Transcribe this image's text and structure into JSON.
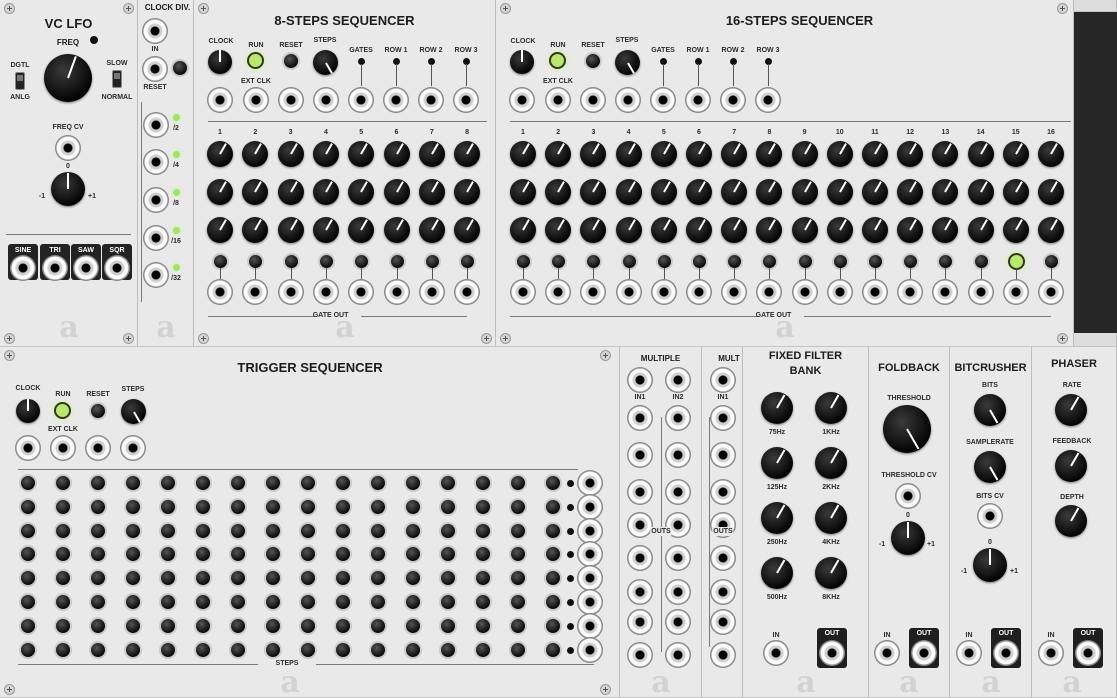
{
  "modules": {
    "vclfo": {
      "title": "VC LFO",
      "freq": "FREQ",
      "dgtl": "DGTL",
      "anlg": "ANLG",
      "slow": "SLOW",
      "normal": "NORMAL",
      "freq_cv": "FREQ CV",
      "zero": "0",
      "minus": "-1",
      "plus": "+1",
      "waves": [
        "SINE",
        "TRI",
        "SAW",
        "SQR"
      ]
    },
    "clockdiv": {
      "title": "CLOCK DIV.",
      "in": "IN",
      "reset": "RESET",
      "divisions": [
        "/2",
        "/4",
        "/8",
        "/16",
        "/32"
      ]
    },
    "seq8": {
      "title": "8-STEPS SEQUENCER",
      "clock": "CLOCK",
      "run": "RUN",
      "ext_clk": "EXT CLK",
      "reset": "RESET",
      "steps": "STEPS",
      "gates": "GATES",
      "rows": [
        "ROW 1",
        "ROW 2",
        "ROW 3"
      ],
      "step_numbers": [
        "1",
        "2",
        "3",
        "4",
        "5",
        "6",
        "7",
        "8"
      ],
      "gate_out": "GATE OUT"
    },
    "seq16": {
      "title": "16-STEPS SEQUENCER",
      "clock": "CLOCK",
      "run": "RUN",
      "ext_clk": "EXT CLK",
      "reset": "RESET",
      "steps": "STEPS",
      "gates": "GATES",
      "rows": [
        "ROW 1",
        "ROW 2",
        "ROW 3"
      ],
      "step_numbers": [
        "1",
        "2",
        "3",
        "4",
        "5",
        "6",
        "7",
        "8",
        "9",
        "10",
        "11",
        "12",
        "13",
        "14",
        "15",
        "16"
      ],
      "gate_out": "GATE OUT"
    },
    "trigseq": {
      "title": "TRIGGER SEQUENCER",
      "clock": "CLOCK",
      "run": "RUN",
      "ext_clk": "EXT CLK",
      "reset": "RESET",
      "steps": "STEPS",
      "steps_footer": "STEPS"
    },
    "multiple": {
      "title": "MULTIPLE",
      "in1": "IN1",
      "in2": "IN2",
      "outs": "OUTS"
    },
    "mult": {
      "title": "MULT",
      "in1": "IN1",
      "outs": "OUTS"
    },
    "filterbank": {
      "title_line1": "FIXED FILTER",
      "title_line2": "BANK",
      "bands": [
        "75Hz",
        "1KHz",
        "125Hz",
        "2KHz",
        "250Hz",
        "4KHz",
        "500Hz",
        "8KHz"
      ],
      "in": "IN",
      "out": "OUT"
    },
    "foldback": {
      "title": "FOLDBACK",
      "threshold": "THRESHOLD",
      "threshold_cv": "THRESHOLD CV",
      "zero": "0",
      "minus": "-1",
      "plus": "+1",
      "in": "IN",
      "out": "OUT"
    },
    "bitcrusher": {
      "title": "BITCRUSHER",
      "bits": "BITS",
      "samplerate": "SAMPLERATE",
      "bits_cv": "BITS CV",
      "zero": "0",
      "minus": "-1",
      "plus": "+1",
      "in": "IN",
      "out": "OUT"
    },
    "phaser": {
      "title": "PHASER",
      "rate": "RATE",
      "feedback": "FEEDBACK",
      "depth": "DEPTH",
      "in": "IN",
      "out": "OUT"
    }
  },
  "seq16_active_step": 15,
  "colors": {
    "panel": "#e9e9e9",
    "led": "#b9e86a",
    "rack": "#2b2b2b"
  }
}
